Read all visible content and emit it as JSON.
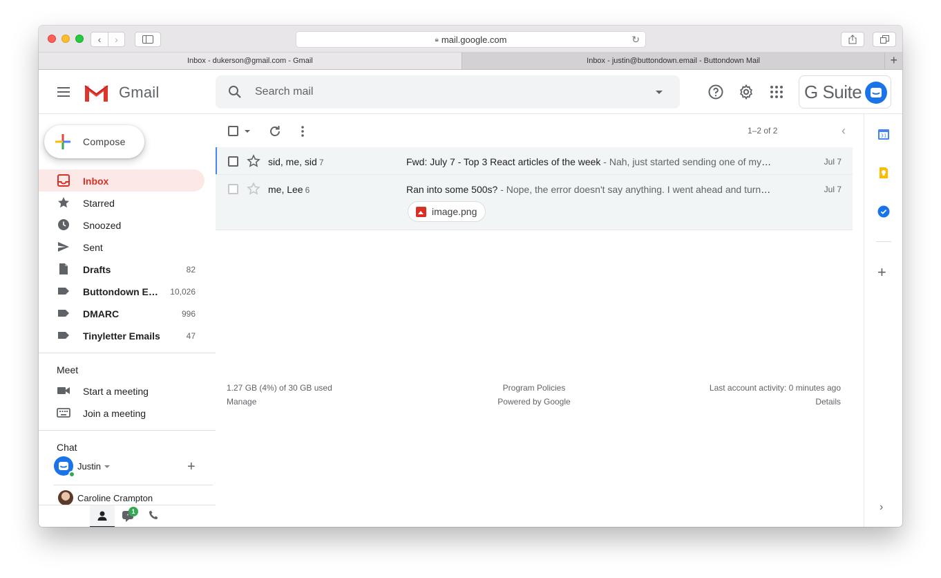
{
  "browser": {
    "url": "mail.google.com",
    "tabs": [
      {
        "label": "Inbox - dukerson@gmail.com - Gmail",
        "active": true
      },
      {
        "label": "Inbox - justin@buttondown.email - Buttondown Mail",
        "active": false
      }
    ]
  },
  "header": {
    "product": "Gmail",
    "search_placeholder": "Search mail",
    "suite_label": "G Suite"
  },
  "compose": {
    "label": "Compose"
  },
  "nav": [
    {
      "label": "Inbox",
      "count": "",
      "icon": "inbox-icon",
      "bold": true,
      "active": true
    },
    {
      "label": "Starred",
      "count": "",
      "icon": "star-icon",
      "bold": false
    },
    {
      "label": "Snoozed",
      "count": "",
      "icon": "clock-icon",
      "bold": false
    },
    {
      "label": "Sent",
      "count": "",
      "icon": "send-icon",
      "bold": false
    },
    {
      "label": "Drafts",
      "count": "82",
      "icon": "draft-icon",
      "bold": true
    },
    {
      "label": "Buttondown E…",
      "count": "10,026",
      "icon": "label-icon",
      "bold": true
    },
    {
      "label": "DMARC",
      "count": "996",
      "icon": "label-icon",
      "bold": true
    },
    {
      "label": "Tinyletter Emails",
      "count": "47",
      "icon": "label-icon",
      "bold": true
    }
  ],
  "meet": {
    "title": "Meet",
    "start": "Start a meeting",
    "join": "Join a meeting"
  },
  "chat": {
    "title": "Chat",
    "user": "Justin",
    "contact": "Caroline Crampton",
    "badge": "1"
  },
  "list": {
    "page_info": "1–2 of 2",
    "rows": [
      {
        "sender": "sid, me, sid",
        "count": "7",
        "subject": "Fwd: July 7 - Top 3 React articles of the week",
        "snippet": " - Nah, just started sending one of my newsletters through Buttondown",
        "date": "Jul 7"
      },
      {
        "sender": "me, Lee",
        "count": "6",
        "subject": "Ran into some 500s?",
        "snippet": " - Nope, the error doesn't say anything. I went ahead and turned it off and on again",
        "date": "Jul 7",
        "attachment": "image.png"
      }
    ]
  },
  "footer": {
    "storage": "1.27 GB (4%) of 30 GB used",
    "manage": "Manage",
    "policies": "Program Policies",
    "powered": "Powered by Google",
    "activity": "Last account activity: 0 minutes ago",
    "details": "Details"
  },
  "rail": {
    "calendar_day": "31"
  }
}
